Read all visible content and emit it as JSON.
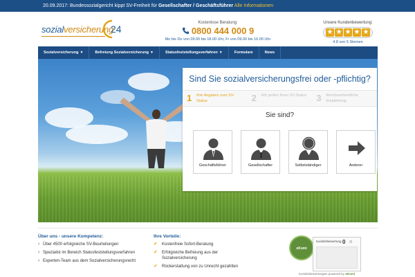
{
  "topbar": {
    "date": "20.09.2017:",
    "news_prefix": "Bundessozialgericht kippt SV-Freiheit für",
    "news_bold": "Gesellschafter / Geschäftsführer",
    "link": "Alle Informationen"
  },
  "logo": {
    "word_main": "sozial",
    "word_highlight": "versicherung",
    "number": "24"
  },
  "contact": {
    "label": "Kostenlose Beratung:",
    "phone": "0800 444 000 9",
    "hours": "Mo bis Do von 09.00 bis 18.00 Uhr, Fr von 09.00 bis 16.00 Uhr"
  },
  "rating": {
    "label": "Unsere Kundenbewertung:",
    "score_text": "4.8 von 5 Sternen",
    "stars": 5
  },
  "nav": {
    "items": [
      {
        "label": "Sozialversicherung",
        "dropdown": true
      },
      {
        "label": "Befreiung Sozialversicherung",
        "dropdown": true
      },
      {
        "label": "Statusfeststellungsverfahren",
        "dropdown": true
      },
      {
        "label": "Formulare",
        "dropdown": false
      },
      {
        "label": "News",
        "dropdown": false
      }
    ]
  },
  "panel": {
    "question": "Sind Sie sozialversicherungsfrei oder -pflichtig?",
    "steps": [
      {
        "number": "1",
        "text": "Ihre Angaben zum SV-Status",
        "active": true
      },
      {
        "number": "2",
        "text": "Wir prüfen Ihren SV-Status",
        "active": false
      },
      {
        "number": "3",
        "text": "Rechtsverbindliche Empfehlung",
        "active": false
      }
    ],
    "subquestion": "Sie sind?",
    "options": [
      {
        "label": "Geschäftsführer",
        "icon": "manager-person-icon"
      },
      {
        "label": "Gesellschafter",
        "icon": "partner-person-icon"
      },
      {
        "label": "Selbstständiger",
        "icon": "freelancer-person-icon"
      },
      {
        "label": "Anderer",
        "icon": "arrow-right-icon"
      }
    ]
  },
  "about": {
    "title": "Über uns - unsere Kompetenz:",
    "items": [
      "Über 4500 erfolgreiche SV-Beurteilungen",
      "Spezialist im Bereich Statusfeststellungsverfahren",
      "Experten-Team aus dem Sozialversicherungsrecht"
    ]
  },
  "advantages": {
    "title": "Ihre Vorteile:",
    "items": [
      "Kostenfreie Sofort-Beratung",
      "Erfolgreiche Befreiung aus der Sozialversicherung",
      "Rückerstattung von zu Unrecht gezahlten"
    ]
  },
  "ekomi": {
    "seal_text": "eKomi",
    "label": "Kundenbewertung",
    "count": "0",
    "of": "/5",
    "caption_prefix": "Kundenbewertungen powered by",
    "caption_brand": "eKomi"
  },
  "colors": {
    "brand_blue": "#1d4c83",
    "accent_orange": "#e4a417"
  }
}
